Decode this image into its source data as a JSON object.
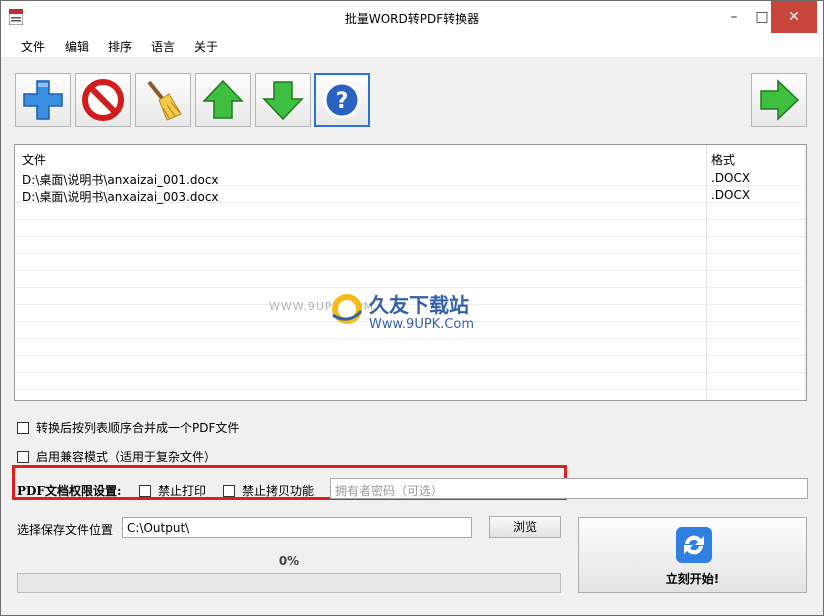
{
  "window": {
    "title": "批量WORD转PDF转换器",
    "controls": {
      "minimize": "–",
      "maximize": "□",
      "close": "✕"
    }
  },
  "menu": [
    "文件",
    "编辑",
    "排序",
    "语言",
    "关于"
  ],
  "toolbar": {
    "buttons": [
      {
        "icon": "plus-icon"
      },
      {
        "icon": "no-entry-icon"
      },
      {
        "icon": "broom-icon"
      },
      {
        "icon": "arrow-up-icon"
      },
      {
        "icon": "arrow-down-icon"
      },
      {
        "icon": "help-icon",
        "selected": true
      },
      {
        "icon": "arrow-right-icon"
      }
    ]
  },
  "file_list": {
    "columns": [
      "文件",
      "格式"
    ],
    "rows": [
      {
        "file": "D:\\桌面\\说明书\\anxaizai_001.docx",
        "format": ".DOCX"
      },
      {
        "file": "D:\\桌面\\说明书\\anxaizai_003.docx",
        "format": ".DOCX"
      }
    ]
  },
  "watermark": {
    "small": "WWW.9UPK.COM",
    "big": "久友下载站",
    "url": "Www.9UPK.Com"
  },
  "options": {
    "merge": "转换后按列表顺序合并成一个PDF文件",
    "compat": "启用兼容模式（适用于复杂文件）"
  },
  "permissions": {
    "label": "PDF文档权限设置:",
    "no_print": "禁止打印",
    "no_copy": "禁止拷贝功能",
    "owner_password_placeholder": "拥有者密码（可选）"
  },
  "save": {
    "label": "选择保存文件位置",
    "path": "C:\\Output\\",
    "browse": "浏览"
  },
  "progress": {
    "text": "0%",
    "value": 0
  },
  "start_button": {
    "label": "立刻开始!"
  },
  "colors": {
    "accent": "#2c6fd6",
    "close_bg": "#c7453a",
    "highlight_box": "#e02020"
  }
}
